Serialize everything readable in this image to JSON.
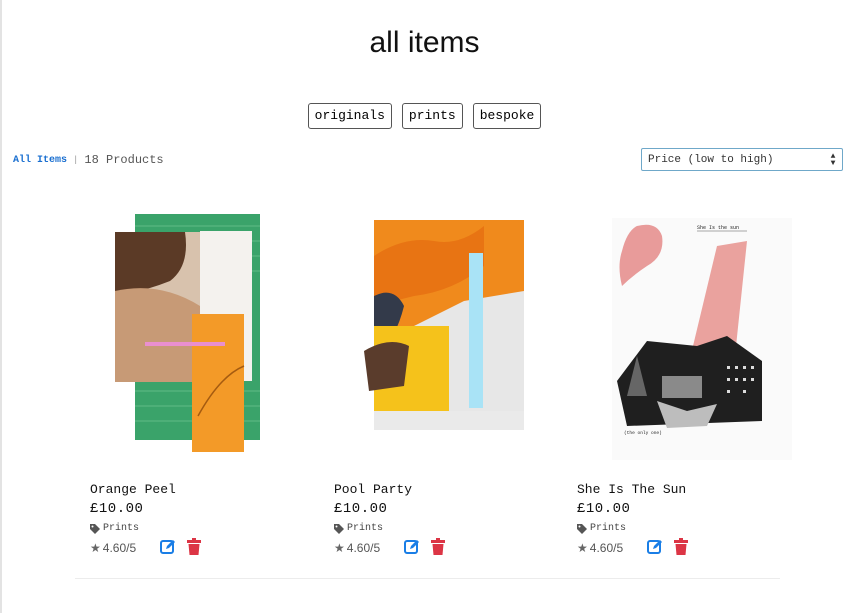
{
  "header": {
    "title": "all items"
  },
  "categories": [
    {
      "label": "originals"
    },
    {
      "label": "prints"
    },
    {
      "label": "bespoke"
    }
  ],
  "breadcrumb": {
    "link": "All Items",
    "separator": "|",
    "count": "18 Products"
  },
  "sort": {
    "selected": "Price (low to high)"
  },
  "products": [
    {
      "name": "Orange Peel",
      "price": "£10.00",
      "category": "Prints",
      "rating": "4.60",
      "rating_max": "/5"
    },
    {
      "name": "Pool Party",
      "price": "£10.00",
      "category": "Prints",
      "rating": "4.60",
      "rating_max": "/5"
    },
    {
      "name": "She Is The Sun",
      "price": "£10.00",
      "category": "Prints",
      "rating": "4.60",
      "rating_max": "/5"
    }
  ],
  "artwork_text": {
    "sun_top": "She Is the    sun",
    "sun_bottom": "(the only one)"
  },
  "colors": {
    "accent_blue": "#1a6fd0",
    "delete_red": "#dc3545",
    "edit_blue": "#1a7ee6"
  }
}
